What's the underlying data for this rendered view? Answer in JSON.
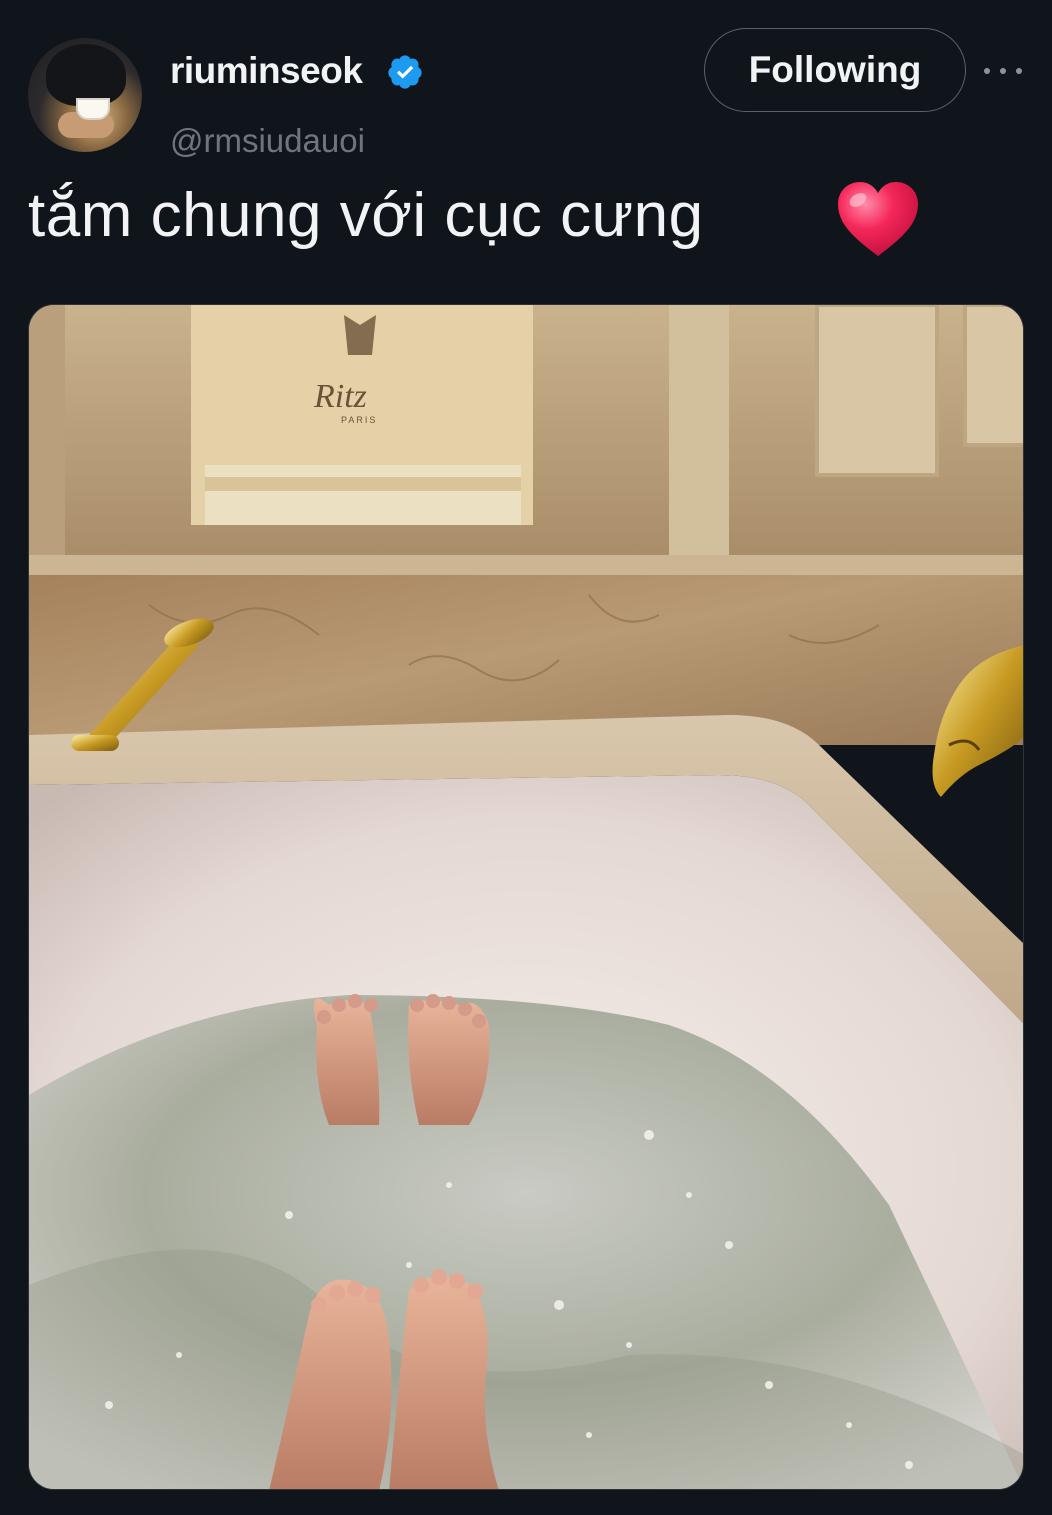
{
  "author": {
    "display_name": "riuminseok",
    "handle": "@rmsiudauoi",
    "verified": true
  },
  "actions": {
    "follow_label": "Following"
  },
  "tweet": {
    "text": "tắm chung với cục cưng",
    "emoji": "heart"
  },
  "media": {
    "towel_brand": "Ritz",
    "towel_sub": "PARIS"
  },
  "colors": {
    "background": "#10151b",
    "verified": "#1d9bf0",
    "handle": "#6e767d",
    "heart": "#f5275a"
  }
}
